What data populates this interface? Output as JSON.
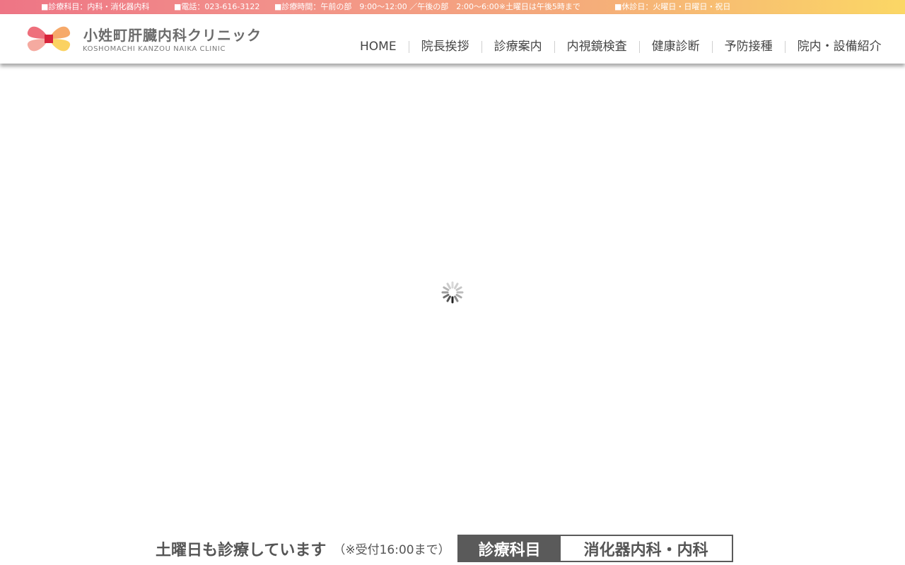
{
  "topbar": {
    "departments": "■診療科目：内科・消化器内科",
    "phone": "■電話：023-616-3122",
    "hours": "■診療時間：午前の部　9:00～12:00 ／午後の部　2:00～6:00※土曜日は午後5時まで",
    "closed": "■休診日：火曜日・日曜日・祝日"
  },
  "header": {
    "logo_name": "小姓町肝臓内科クリニック",
    "logo_sub": "KOSHOMACHI KANZOU NAIKA CLINIC",
    "nav": [
      {
        "label": "HOME"
      },
      {
        "label": "院長挨拶"
      },
      {
        "label": "診療案内"
      },
      {
        "label": "内視鏡検査"
      },
      {
        "label": "健康診断"
      },
      {
        "label": "予防接種"
      },
      {
        "label": "院内・設備紹介"
      }
    ]
  },
  "main": {
    "loading_icon": "spinner-icon"
  },
  "bottom_bar": {
    "saturday_text": "土曜日も診療しています",
    "saturday_note": "（※受付16:00まで）",
    "dept_label": "診療科目",
    "dept_value": "消化器内科・内科"
  },
  "colors": {
    "topbar_gradient_start": "#ee7585",
    "topbar_gradient_end": "#fbd765",
    "logo_pink": "#ee6f7c",
    "logo_orange": "#f6a96a",
    "logo_yellow": "#fbd261",
    "logo_center": "#d7243b",
    "dept_label_bg": "#5a5a5a"
  }
}
